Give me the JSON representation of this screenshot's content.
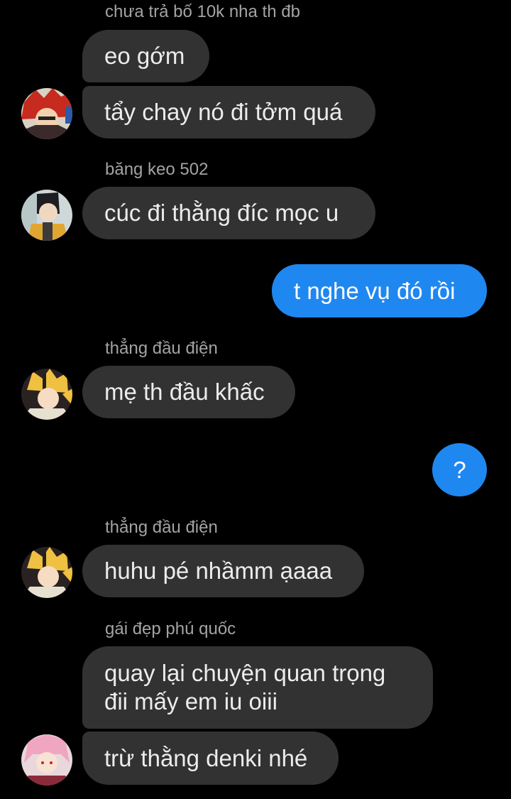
{
  "messages": [
    {
      "sender": "chưa trả bố 10k nha th đb",
      "lines": [
        "eo gớm"
      ]
    },
    {
      "lines": [
        "tẩy chay nó đi tởm quá"
      ]
    },
    {
      "sender": "băng keo 502",
      "lines": [
        "cúc đi thằng đíc mọc u"
      ]
    },
    {
      "mine": true,
      "lines": [
        "t nghe vụ đó rồi"
      ]
    },
    {
      "sender": "thẳng đầu điện",
      "lines": [
        "mẹ th đầu khấc"
      ]
    },
    {
      "mine": true,
      "lines": [
        "?"
      ]
    },
    {
      "sender": "thẳng đầu điện",
      "lines": [
        "huhu pé nhầmm ạaaa"
      ]
    },
    {
      "sender": "gái đẹp phú quốc",
      "lines": [
        "quay lại chuyện quan trọng",
        "đii mấy em iu oiii"
      ]
    },
    {
      "lines": [
        "trừ thằng denki nhé"
      ]
    }
  ],
  "colors": {
    "background": "#000000",
    "incoming_bubble": "#323232",
    "outgoing_bubble": "#1f87f0",
    "sender_name": "#a3a3a3"
  }
}
